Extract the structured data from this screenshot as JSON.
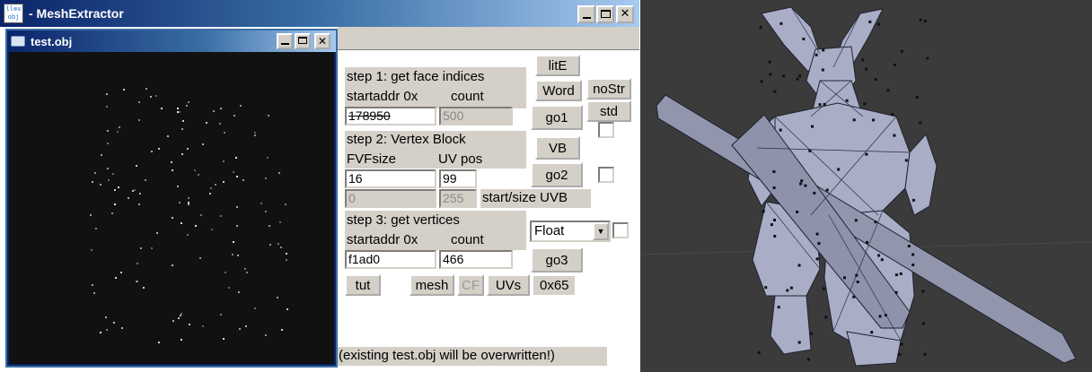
{
  "main_window": {
    "icon_text_line1": "ll⊗x",
    "icon_text_line2": "obj",
    "title": "- MeshExtractor",
    "minimize_glyph": "_",
    "maximize_glyph": "□",
    "close_glyph": "✕"
  },
  "child_window": {
    "title": "test.obj",
    "close_glyph": "✕"
  },
  "panel": {
    "step1": {
      "title": "step 1: get face indices",
      "startaddr_label": "startaddr 0x",
      "count_label": "count",
      "startaddr_value": "178950",
      "count_value": "500"
    },
    "step2": {
      "title": "step 2: Vertex Block",
      "fvfsize_label": "FVFsize",
      "uvpos_label": "UV pos",
      "fvfsize_value": "16",
      "uvpos_value": "99",
      "start_uvb_value": "0",
      "size_uvb_value": "255",
      "start_size_label": "start/size UVB"
    },
    "step3": {
      "title": "step 3: get vertices",
      "startaddr_label": "startaddr 0x",
      "count_label": "count",
      "startaddr_value": "f1ad0",
      "count_value": "466"
    },
    "buttons": {
      "lite": "litE",
      "word": "Word",
      "nostr": "noStr",
      "std": "std",
      "go1": "go1",
      "vb": "VB",
      "go2": "go2",
      "go3": "go3",
      "tut": "tut",
      "mesh": "mesh",
      "cf": "CF",
      "uvs": "UVs"
    },
    "format_select": "Float",
    "hex_readout": "0x65",
    "warning": "(existing test.obj will be overwritten!)"
  },
  "colors": {
    "title_active_start": "#0a246a",
    "title_active_end": "#a6caf0",
    "face_gray": "#d4d0c8",
    "viewport_bg": "#111111",
    "view3d_bg": "#3b3b3b",
    "mesh_fill": "#a9adc6"
  }
}
